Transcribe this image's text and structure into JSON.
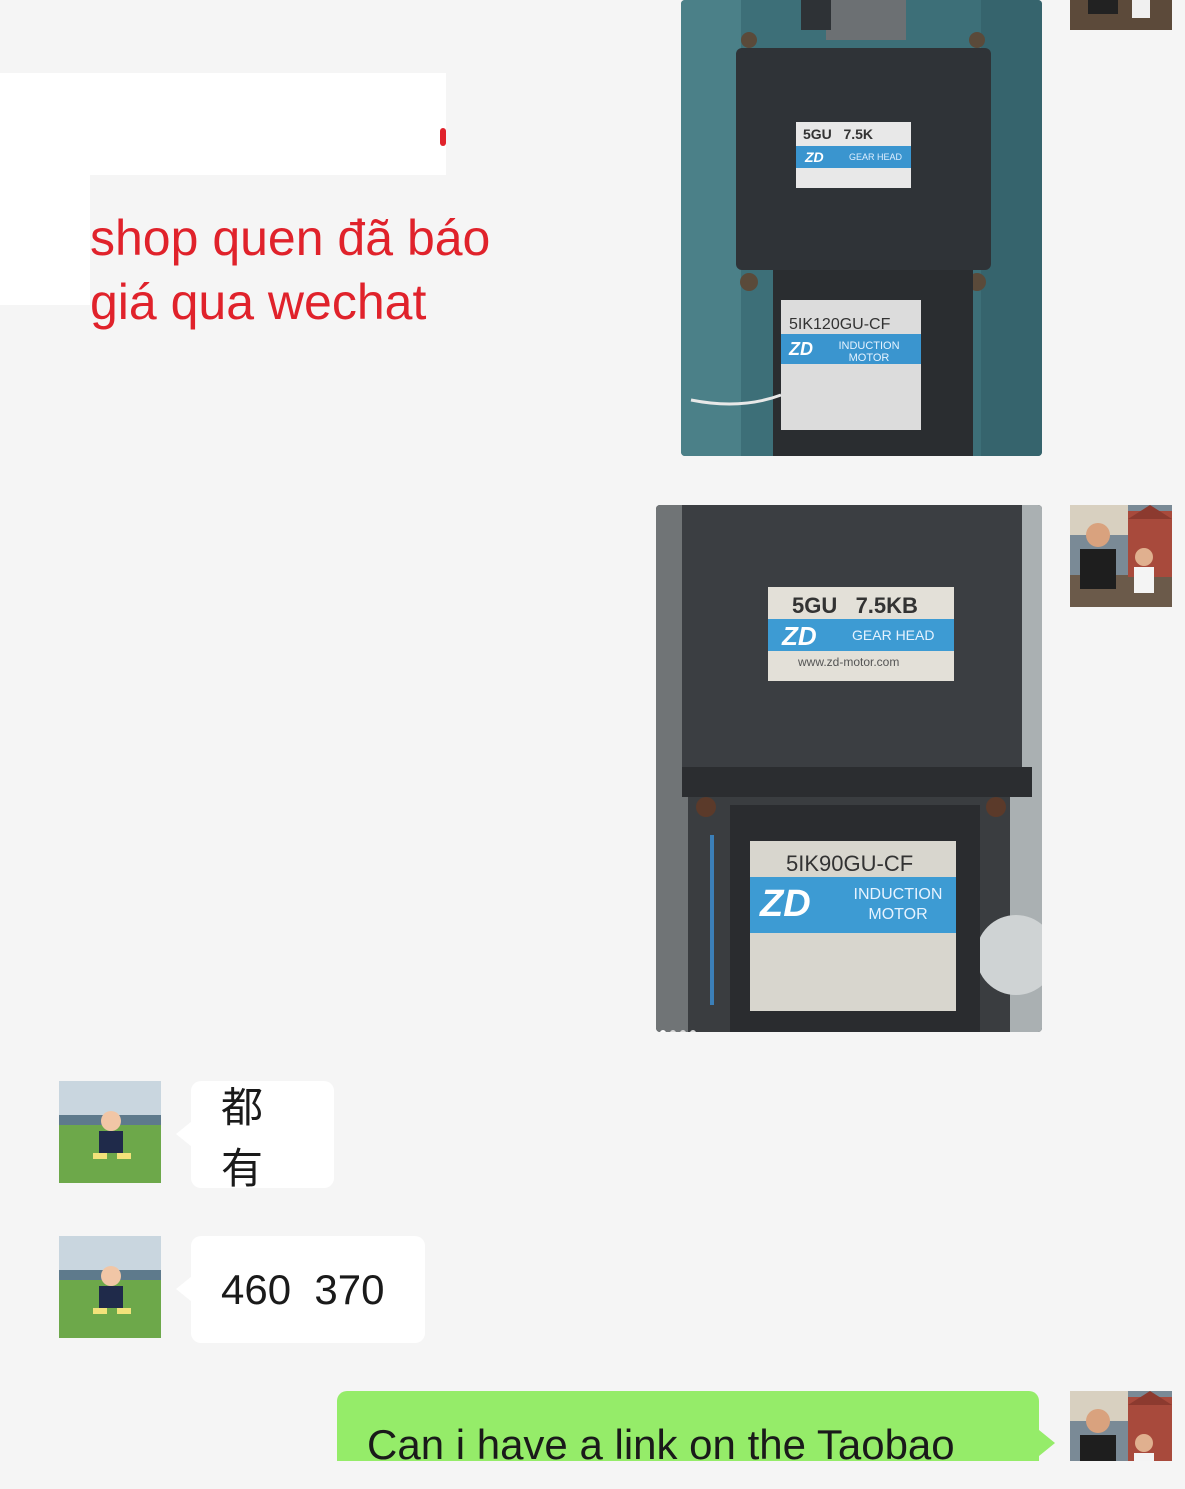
{
  "overlay_note": {
    "text": "shop quen đã báo giá qua wechat",
    "color": "#e0222b"
  },
  "messages": [
    {
      "sender": "me",
      "type": "image",
      "label_top": "5GU   7.5K",
      "label_bottom": "5IK120GU-CF",
      "brand": "ZD",
      "sub_top": "GEAR HEAD",
      "sub_bottom": "INDUCTION MOTOR"
    },
    {
      "sender": "me",
      "type": "image",
      "label_top": "5GU   7.5KB",
      "label_bottom": "5IK90GU-CF",
      "brand": "ZD",
      "sub_top": "GEAR HEAD",
      "sub_bottom": "INDUCTION MOTOR",
      "site": "www.zd-motor.com"
    },
    {
      "sender": "other",
      "type": "text",
      "text": "都有"
    },
    {
      "sender": "other",
      "type": "text",
      "text": "460  370"
    },
    {
      "sender": "me",
      "type": "text",
      "text": "Can i have a link on the Taobao"
    }
  ],
  "colors": {
    "background": "#f5f5f5",
    "bubble_other": "#ffffff",
    "bubble_me": "#95ec69",
    "annotation_red": "#e0222b"
  },
  "icons": {
    "my_avatar": "avatar-adult-with-child",
    "other_avatar": "avatar-toddler-on-grass"
  }
}
